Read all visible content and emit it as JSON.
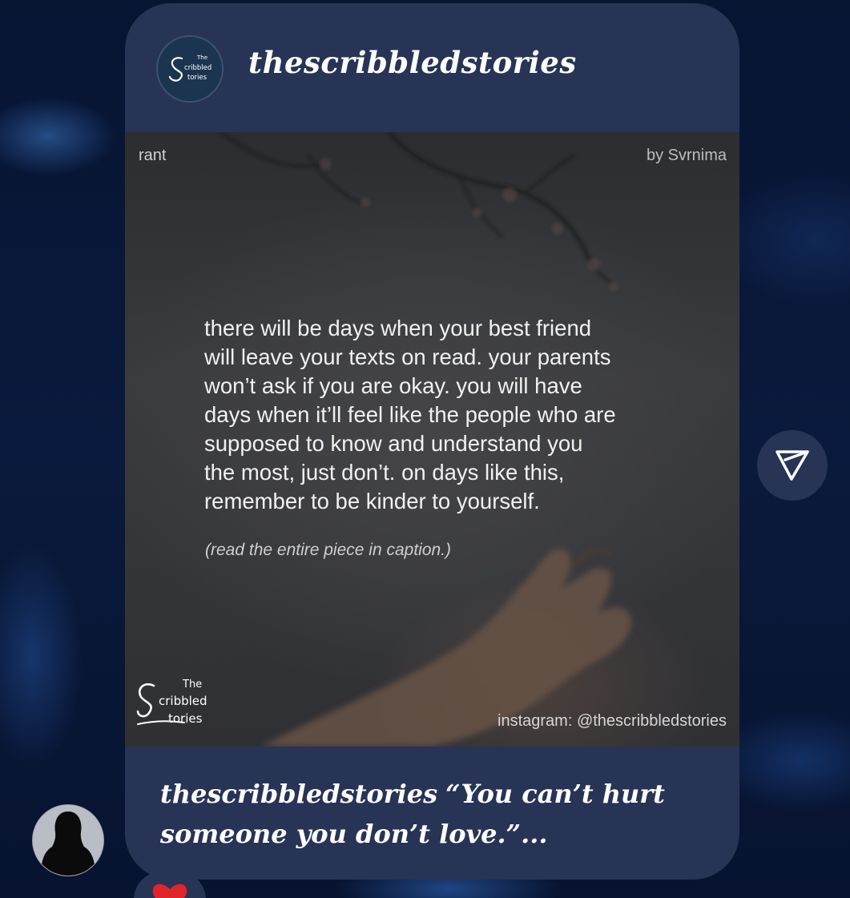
{
  "post": {
    "username": "thescribbledstories",
    "tag": "rant",
    "author": "by Svrnima",
    "quote_lines": [
      "there will be days when your best friend",
      "will leave your texts on read. your parents",
      "won’t ask if you are okay. you will have",
      "days when it’ll feel like the people who are",
      "supposed to know and understand you",
      "the most, just don’t. on days like this,",
      "remember to be kinder to yourself."
    ],
    "read_more": "(read the entire piece in caption.)",
    "watermark": "instagram: @thescribbledstories",
    "logo_text": {
      "line1": "The",
      "line2": "cribbled",
      "line3": "tories"
    },
    "caption": {
      "username": "thescribbledstories",
      "line1_text": "“You can’t hurt",
      "line2_text": "someone you don’t love.”..."
    }
  },
  "icons": {
    "share": "send-icon",
    "reaction": "heart-icon"
  },
  "colors": {
    "card_bg": "#273456",
    "page_bg": "#071330",
    "heart": "#e0242c"
  }
}
